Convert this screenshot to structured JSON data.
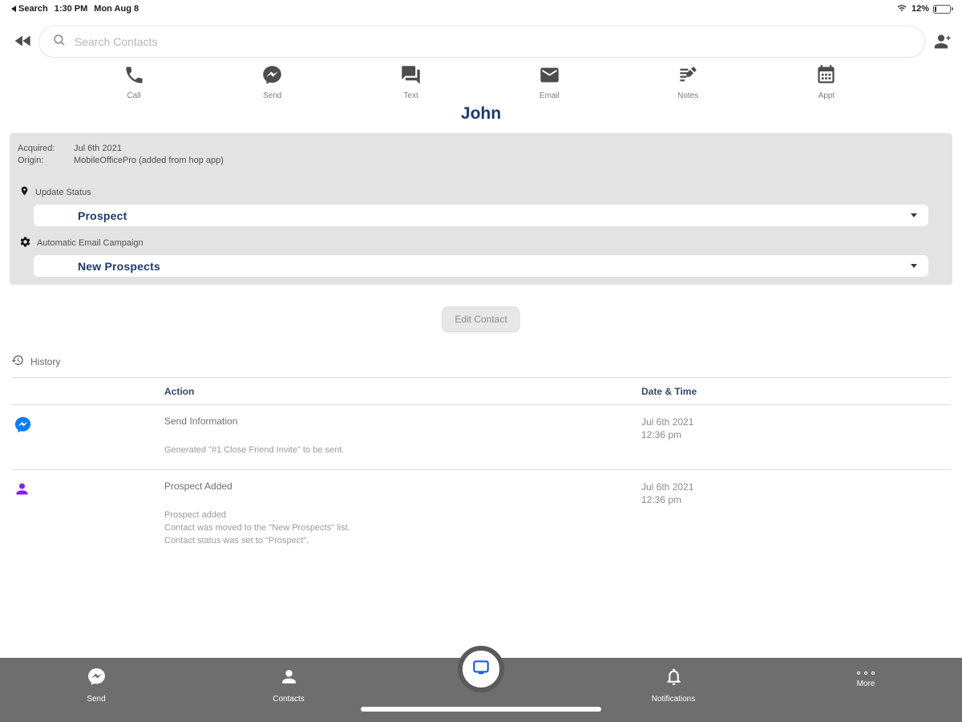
{
  "status_bar": {
    "back_label": "Search",
    "time": "1:30 PM",
    "date": "Mon Aug 8",
    "battery_percent": "12%"
  },
  "header": {
    "search_placeholder": "Search Contacts"
  },
  "actions": [
    {
      "icon": "phone-icon",
      "label": "Call"
    },
    {
      "icon": "messenger-icon",
      "label": "Send"
    },
    {
      "icon": "chat-bubbles-icon",
      "label": "Text"
    },
    {
      "icon": "envelope-icon",
      "label": "Email"
    },
    {
      "icon": "notes-pen-icon",
      "label": "Notes"
    },
    {
      "icon": "calendar-icon",
      "label": "Appt"
    }
  ],
  "contact": {
    "name": "John",
    "acquired_label": "Acquired:",
    "acquired_value": "Jul 6th 2021",
    "origin_label": "Origin:",
    "origin_value": "MobileOfficePro (added from hop app)",
    "update_status_label": "Update Status",
    "status_value": "Prospect",
    "campaign_label": "Automatic Email Campaign",
    "campaign_value": "New Prospects",
    "edit_button_label": "Edit Contact"
  },
  "history": {
    "title": "History",
    "columns": [
      "Action",
      "Date & Time"
    ],
    "rows": [
      {
        "icon": "messenger-icon",
        "action": "Send Information",
        "details": [
          "Generated \"#1 Close Friend Invite\" to be sent."
        ],
        "date": "Jul 6th 2021",
        "time": "12:36 pm"
      },
      {
        "icon": "person-icon",
        "action": "Prospect Added",
        "details": [
          "Prospect added",
          "Contact was moved to the \"New Prospects\" list.",
          "Contact status was set to \"Prospect\"."
        ],
        "date": "Jul 6th 2021",
        "time": "12:36 pm"
      }
    ]
  },
  "bottom_nav": {
    "items": [
      {
        "icon": "messenger-icon",
        "label": "Send"
      },
      {
        "icon": "person-icon",
        "label": "Contacts"
      },
      {
        "icon": "monitor-icon",
        "label": ""
      },
      {
        "icon": "bell-icon",
        "label": "Notifications"
      },
      {
        "icon": "dots-icon",
        "label": "More"
      }
    ]
  },
  "colors": {
    "accent_navy": "#1c3b6e",
    "messenger_blue": "#0a7cff",
    "history_purple": "#8b1bf5",
    "nav_gray": "#6e6e6e",
    "panel_gray": "#e3e3e3"
  }
}
